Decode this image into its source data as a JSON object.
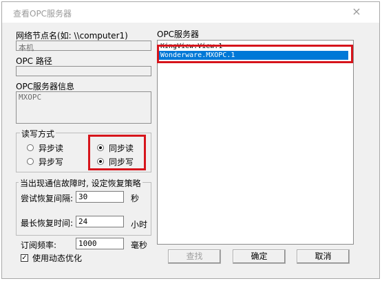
{
  "window": {
    "title": "查看OPC服务器",
    "close_symbol": "×"
  },
  "node": {
    "label": "网络节点名(如: \\\\computer1)",
    "value": "本机"
  },
  "path": {
    "label": "OPC 路径",
    "value": ""
  },
  "info": {
    "label": "OPC服务器信息",
    "value": "MXOPC"
  },
  "servers": {
    "label": "OPC服务器",
    "items": [
      {
        "text": "KingView.View.1",
        "selected": false
      },
      {
        "text": "Wonderware.MXOPC.1",
        "selected": true
      }
    ]
  },
  "rw_mode": {
    "title": "读写方式",
    "async_read": "异步读",
    "async_write": "异步写",
    "sync_read": "同步读",
    "sync_write": "同步写",
    "read_selected": "sync",
    "write_selected": "sync"
  },
  "recovery": {
    "title": "当出现通信故障时, 设定恢复策略",
    "interval_label": "尝试恢复间隔:",
    "interval_value": "30",
    "interval_unit": "秒",
    "max_label": "最长恢复时间:",
    "max_value": "24",
    "max_unit": "小时"
  },
  "subscribe": {
    "label": "订阅频率:",
    "value": "1000",
    "unit": "毫秒"
  },
  "dynamic_opt": {
    "label": "使用动态优化",
    "checked": true,
    "check_mark": "✓"
  },
  "buttons": {
    "find": "查找",
    "ok": "确定",
    "cancel": "取消"
  },
  "colors": {
    "highlight_red": "#d6141b",
    "selection_blue": "#0078d7"
  }
}
